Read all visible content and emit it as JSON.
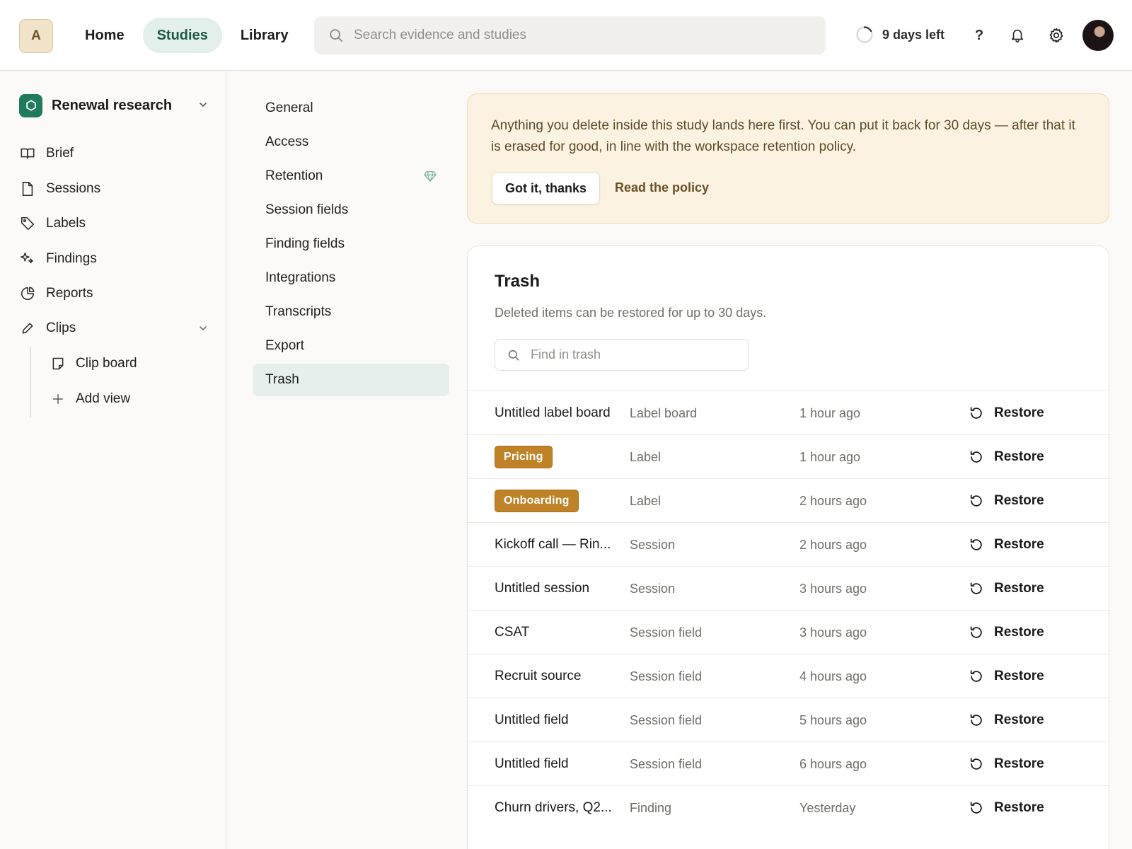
{
  "topbar": {
    "workspace_initial": "A",
    "nav": [
      {
        "label": "Home"
      },
      {
        "label": "Studies",
        "active": true
      },
      {
        "label": "Library"
      }
    ],
    "search_placeholder": "Search evidence and studies",
    "trial_label": "9 days left",
    "help_label": "?",
    "icons": [
      "search-icon",
      "spinner-icon",
      "bell-icon",
      "gear-icon"
    ]
  },
  "sidebar": {
    "project_name": "Renewal research",
    "items": [
      {
        "label": "Brief",
        "icon": "book-icon"
      },
      {
        "label": "Sessions",
        "icon": "file-icon"
      },
      {
        "label": "Labels",
        "icon": "tag-icon"
      },
      {
        "label": "Findings",
        "icon": "sparkle-icon"
      },
      {
        "label": "Reports",
        "icon": "pie-chart-icon"
      },
      {
        "label": "Clips",
        "icon": "pencil-icon"
      }
    ],
    "sub_items": [
      {
        "label": "Clip board",
        "icon": "note-icon"
      },
      {
        "label": "Add view",
        "icon": "plus-icon"
      }
    ]
  },
  "settings_nav": {
    "items": [
      {
        "label": "General"
      },
      {
        "label": "Access"
      },
      {
        "label": "Retention"
      },
      {
        "label": "Session fields"
      },
      {
        "label": "Finding fields"
      },
      {
        "label": "Integrations"
      },
      {
        "label": "Transcripts"
      },
      {
        "label": "Export"
      },
      {
        "label": "Trash",
        "active": true
      }
    ]
  },
  "notice": {
    "text": "Anything you delete inside this study lands here first. You can put it back for 30 days — after that it is erased for good, in line with the workspace retention policy.",
    "ack_label": "Got it, thanks",
    "link_label": "Read the policy"
  },
  "trash": {
    "title": "Trash",
    "subtitle": "Deleted items can be restored for up to 30 days.",
    "search_placeholder": "Find in trash",
    "restore_label": "Restore",
    "rows": [
      {
        "name": "Untitled label board",
        "type": "Label board",
        "time": "1 hour ago",
        "tag": false
      },
      {
        "name": "Pricing",
        "type": "Label",
        "time": "1 hour ago",
        "tag": true
      },
      {
        "name": "Onboarding",
        "type": "Label",
        "time": "2 hours ago",
        "tag": true
      },
      {
        "name": "Kickoff call — Rin...",
        "type": "Session",
        "time": "2 hours ago",
        "tag": false
      },
      {
        "name": "Untitled session",
        "type": "Session",
        "time": "3 hours ago",
        "tag": false
      },
      {
        "name": "CSAT",
        "type": "Session field",
        "time": "3 hours ago",
        "tag": false
      },
      {
        "name": "Recruit source",
        "type": "Session field",
        "time": "4 hours ago",
        "tag": false
      },
      {
        "name": "Untitled field",
        "type": "Session field",
        "time": "5 hours ago",
        "tag": false
      },
      {
        "name": "Untitled field",
        "type": "Session field",
        "time": "6 hours ago",
        "tag": false
      },
      {
        "name": "Churn drivers, Q2...",
        "type": "Finding",
        "time": "Yesterday",
        "tag": false
      }
    ]
  },
  "colors": {
    "accent": "#1f5a49",
    "active_tab_bg": "#e2efea",
    "notice_bg": "#fcf2e1",
    "tag_bg": "#c08226"
  }
}
